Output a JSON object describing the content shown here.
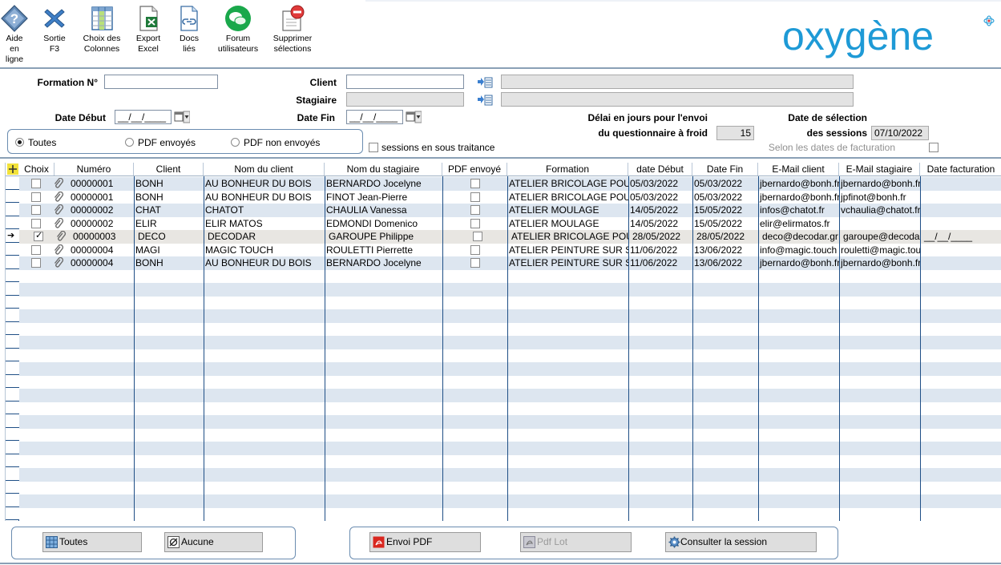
{
  "toolbar": {
    "help": "Aide en ligne",
    "exit": "Sortie F3",
    "columns": "Choix des Colonnes",
    "excel": "Export Excel",
    "docs": "Docs liés",
    "forum": "Forum utilisateurs",
    "delete": "Supprimer sélections"
  },
  "logo": {
    "text": "oxygène",
    "color": "#1e9ad6"
  },
  "form": {
    "formation_label": "Formation N°",
    "formation_value": "",
    "client_label": "Client",
    "client_value": "",
    "client_name_value": "",
    "stagiaire_label": "Stagiaire",
    "stagiaire_value": "",
    "stagiaire_name_value": "",
    "date_debut_label": "Date Début",
    "date_debut_value": "__/__/____",
    "date_fin_label": "Date Fin",
    "date_fin_value": "__/__/____",
    "delai_label_1": "Délai en jours pour l'envoi",
    "delai_label_2": "du questionnaire à froid",
    "delai_value": "15",
    "date_sel_label_1": "Date de sélection",
    "date_sel_label_2": "des sessions",
    "date_sel_value": "07/10/2022",
    "facturation_label": "Selon les dates de facturation",
    "sous_traitance_label": "sessions en sous traitance",
    "radio_all": "Toutes",
    "radio_sent": "PDF envoyés",
    "radio_not_sent": "PDF non envoyés"
  },
  "grid": {
    "columns": {
      "choix": "Choix",
      "numero": "Numéro",
      "client": "Client",
      "nom_client": "Nom du client",
      "nom_stagiaire": "Nom du stagiaire",
      "pdf": "PDF envoyé",
      "formation": "Formation",
      "date_debut": "date Début",
      "date_fin": "Date Fin",
      "email_client": "E-Mail client",
      "email_stagiaire": "E-Mail stagiaire",
      "date_facturation": "Date facturation"
    },
    "rows": [
      {
        "checked": false,
        "numero": "00000001",
        "client": "BONH",
        "nom_client": "AU BONHEUR DU BOIS",
        "nom_stagiaire": "BERNARDO Jocelyne",
        "pdf": false,
        "formation": "ATELIER BRICOLAGE POU",
        "date_debut": "05/03/2022",
        "date_fin": "05/03/2022",
        "email_client": "jbernardo@bonh.fr",
        "email_stagiaire": "jbernardo@bonh.fr",
        "date_facturation": ""
      },
      {
        "checked": false,
        "numero": "00000001",
        "client": "BONH",
        "nom_client": "AU BONHEUR DU BOIS",
        "nom_stagiaire": "FINOT Jean-Pierre",
        "pdf": false,
        "formation": "ATELIER BRICOLAGE POU",
        "date_debut": "05/03/2022",
        "date_fin": "05/03/2022",
        "email_client": "jbernardo@bonh.fr",
        "email_stagiaire": "jpfinot@bonh.fr",
        "date_facturation": ""
      },
      {
        "checked": false,
        "numero": "00000002",
        "client": "CHAT",
        "nom_client": "CHATOT",
        "nom_stagiaire": "CHAULIA Vanessa",
        "pdf": false,
        "formation": "ATELIER MOULAGE",
        "date_debut": "14/05/2022",
        "date_fin": "15/05/2022",
        "email_client": "infos@chatot.fr",
        "email_stagiaire": "vchaulia@chatot.fr",
        "date_facturation": ""
      },
      {
        "checked": false,
        "numero": "00000002",
        "client": "ELIR",
        "nom_client": "ELIR MATOS",
        "nom_stagiaire": "EDMONDI Domenico",
        "pdf": false,
        "formation": "ATELIER MOULAGE",
        "date_debut": "14/05/2022",
        "date_fin": "15/05/2022",
        "email_client": "elir@elirmatos.fr",
        "email_stagiaire": "",
        "date_facturation": ""
      },
      {
        "checked": true,
        "numero": "00000003",
        "client": "DECO",
        "nom_client": "DECODAR",
        "nom_stagiaire": "GAROUPE Philippe",
        "pdf": false,
        "formation": "ATELIER BRICOLAGE POU",
        "date_debut": "28/05/2022",
        "date_fin": "28/05/2022",
        "email_client": "deco@decodar.gr",
        "email_stagiaire": "garoupe@decoda",
        "date_facturation": "__/__/____"
      },
      {
        "checked": false,
        "numero": "00000004",
        "client": "MAGI",
        "nom_client": "MAGIC TOUCH",
        "nom_stagiaire": "ROULETTI Pierrette",
        "pdf": false,
        "formation": "ATELIER PEINTURE SUR S",
        "date_debut": "11/06/2022",
        "date_fin": "13/06/2022",
        "email_client": "info@magic.touch",
        "email_stagiaire": "rouletti@magic.tou",
        "date_facturation": ""
      },
      {
        "checked": false,
        "numero": "00000004",
        "client": "BONH",
        "nom_client": "AU BONHEUR DU BOIS",
        "nom_stagiaire": "BERNARDO Jocelyne",
        "pdf": false,
        "formation": "ATELIER PEINTURE SUR S",
        "date_debut": "11/06/2022",
        "date_fin": "13/06/2022",
        "email_client": "jbernardo@bonh.fr",
        "email_stagiaire": "jbernardo@bonh.fr",
        "date_facturation": ""
      }
    ],
    "current_row": 4
  },
  "buttons": {
    "all": "Toutes",
    "none": "Aucune",
    "send_pdf": "Envoi PDF",
    "pdf_lot": "Pdf Lot",
    "consult": "Consulter la session"
  }
}
